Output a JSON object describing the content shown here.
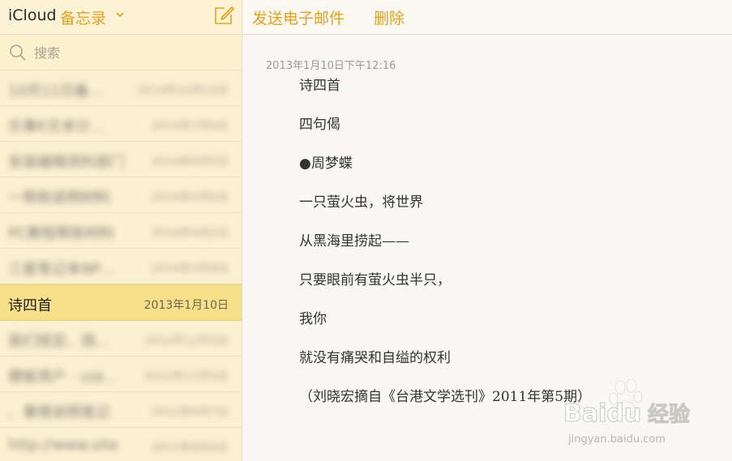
{
  "sidebar": {
    "brand": "iCloud",
    "folder": "备忘录",
    "search_placeholder": "搜索",
    "notes": [
      {
        "title": "10月11日备…",
        "date": "2014年10月10日",
        "blurred": true
      },
      {
        "title": "乐事K文本计…",
        "date": "2014年7月9日",
        "blurred": true
      },
      {
        "title": "安装编辑资料部门",
        "date": "2014年6月5日",
        "blurred": true
      },
      {
        "title": "一帮助说明材料",
        "date": "2014年5月6日",
        "blurred": true
      },
      {
        "title": "PC教程帮助材料",
        "date": "2014年4月2日",
        "blurred": true
      },
      {
        "title": "三星笔记本NP…",
        "date": "2014年3月8日",
        "blurred": true
      },
      {
        "title": "诗四首",
        "date": "2013年1月10日",
        "blurred": false,
        "selected": true
      },
      {
        "title": "我们规定、规…",
        "date": "2012年12月3日",
        "blurred": true
      },
      {
        "title": "模板用户 · uid…",
        "date": "2012年11月5日",
        "blurred": true
      },
      {
        "title": "、事情说明笔记",
        "date": "2012年9月7日",
        "blurred": true
      },
      {
        "title": "http://www.site",
        "date": "2012年8月4日",
        "blurred": true
      }
    ]
  },
  "toolbar": {
    "email_label": "发送电子邮件",
    "delete_label": "删除"
  },
  "note": {
    "datetime": "2013年1月10日下午12:16",
    "lines": [
      "诗四首",
      "四句偈",
      "●周梦蝶",
      "一只萤火虫，将世界",
      "从黑海里捞起——",
      "只要眼前有萤火虫半只，",
      "我你",
      "就没有痛哭和自缢的权利",
      "（刘晓宏摘自《台港文学选刊》2011年第5期）"
    ]
  },
  "watermark": {
    "brand": "Baidu",
    "brand_suffix": "经验",
    "url": "jingyan.baidu.com"
  },
  "icons": {
    "folder_dropdown": "chevron-down-icon",
    "compose": "compose-icon",
    "search": "search-icon"
  },
  "colors": {
    "accent": "#e2a21b",
    "sidebar_bg": "#fbf1cf",
    "selected_bg": "#f6e08a",
    "content_bg": "#f8f7f3"
  }
}
